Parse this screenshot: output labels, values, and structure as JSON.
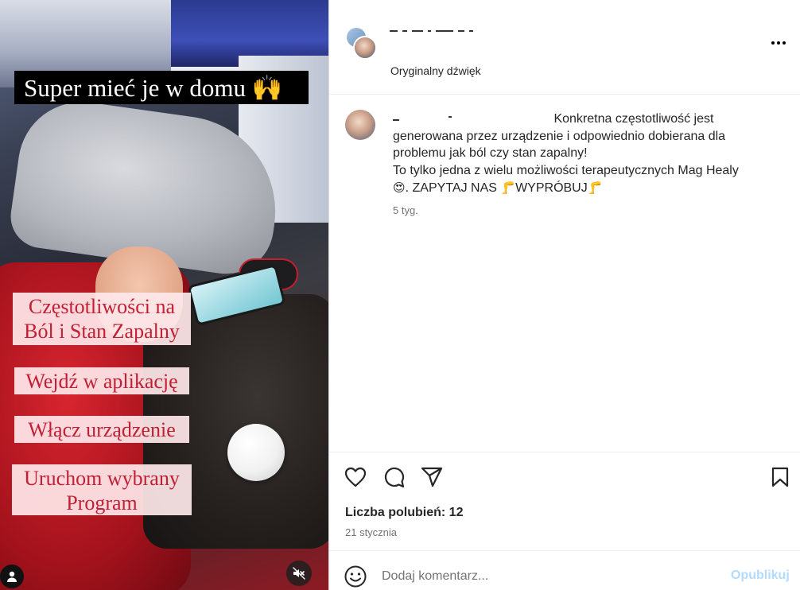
{
  "media": {
    "title_overlay": "Super mieć je w domu 🙌",
    "captions": [
      "Częstotliwości na\nBól i Stan Zapalny",
      "Wejdź w aplikację",
      "Włącz urządzenie",
      "Uruchom wybrany\nProgram"
    ],
    "caption_text_color": "#c21f34",
    "caption_bg_color": "#ffe8ea"
  },
  "header": {
    "audio_label": "Oryginalny dźwięk"
  },
  "comment": {
    "lines": [
      "Konkretna częstotliwość jest",
      "generowana przez urządzenie i odpowiednio dobierana dla",
      "problemu jak ból czy stan zapalny!",
      "To tylko jedna z wielu możliwości terapeutycznych Mag Healy"
    ],
    "last_line_part1": ". ZAPYTAJ NAS ",
    "last_line_part2": "WYPRÓBUJ",
    "emoji_heart_eyes": "😍",
    "emoji_leg": "🦵",
    "time": "5 tyg."
  },
  "footer": {
    "likes": "Liczba polubień: 12",
    "date": "21 stycznia",
    "comment_placeholder": "Dodaj komentarz...",
    "publish_label": "Opublikuj"
  },
  "icons": {
    "like": "heart-icon",
    "comment": "speech-bubble-icon",
    "share": "paper-plane-icon",
    "save": "bookmark-icon",
    "emoji": "smiley-icon",
    "more": "more-dots-icon",
    "mute": "muted-speaker-icon",
    "tagged_user": "user-icon"
  },
  "colors": {
    "publish_disabled": "#b3dbff",
    "secondary_text": "#737373"
  }
}
